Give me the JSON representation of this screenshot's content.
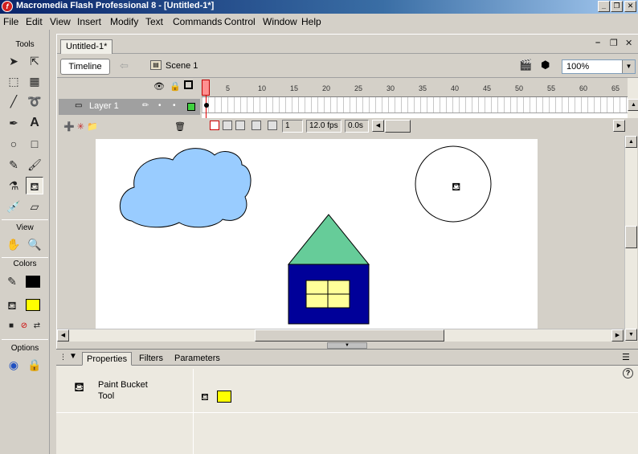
{
  "window": {
    "title": "Macromedia Flash Professional 8 - [Untitled-1*]",
    "minimize": "_",
    "restore": "❐",
    "close": "✕"
  },
  "menu": [
    "File",
    "Edit",
    "View",
    "Insert",
    "Modify",
    "Text",
    "Commands",
    "Control",
    "Window",
    "Help"
  ],
  "tools": {
    "header": "Tools",
    "view_header": "View",
    "colors_header": "Colors",
    "options_header": "Options",
    "stroke_color": "#000000",
    "fill_color": "#ffff00"
  },
  "document": {
    "tab": "Untitled-1*",
    "timeline_button": "Timeline",
    "scene": "Scene 1",
    "zoom": "100%"
  },
  "timeline": {
    "layer_name": "Layer 1",
    "frame_ticks": [
      "1",
      "5",
      "10",
      "15",
      "20",
      "25",
      "30",
      "35",
      "40",
      "45",
      "50",
      "55",
      "60",
      "65"
    ],
    "current_frame": "1",
    "frame_rate": "12.0 fps",
    "elapsed": "0.0s"
  },
  "stage": {
    "cloud_color": "#99ccff",
    "roof_color": "#66cc99",
    "house_color": "#000099",
    "window_color": "#ffff99"
  },
  "properties": {
    "tabs": [
      "Properties",
      "Filters",
      "Parameters"
    ],
    "tool_name": "Paint Bucket Tool",
    "fill_swatch": "#ffff00",
    "help": "?"
  }
}
